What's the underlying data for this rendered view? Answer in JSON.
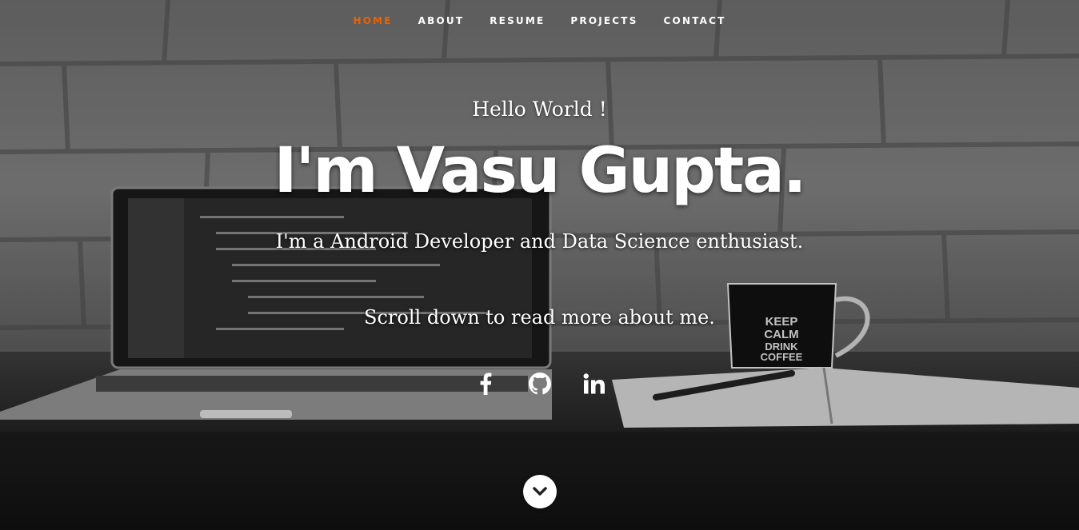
{
  "nav": {
    "items": [
      {
        "label": "HOME",
        "active": true
      },
      {
        "label": "ABOUT",
        "active": false
      },
      {
        "label": "RESUME",
        "active": false
      },
      {
        "label": "PROJECTS",
        "active": false
      },
      {
        "label": "CONTACT",
        "active": false
      }
    ],
    "active_color": "#f06000"
  },
  "hero": {
    "greeting": "Hello World !",
    "name": "I'm Vasu Gupta.",
    "tagline": "I'm a Android Developer and Data Science enthusiast.",
    "scroll_text": "Scroll down to read more about me."
  },
  "social": [
    {
      "icon": "facebook-icon"
    },
    {
      "icon": "github-icon"
    },
    {
      "icon": "linkedin-icon"
    }
  ],
  "scroll_down": {
    "icon": "chevron-down-icon"
  }
}
